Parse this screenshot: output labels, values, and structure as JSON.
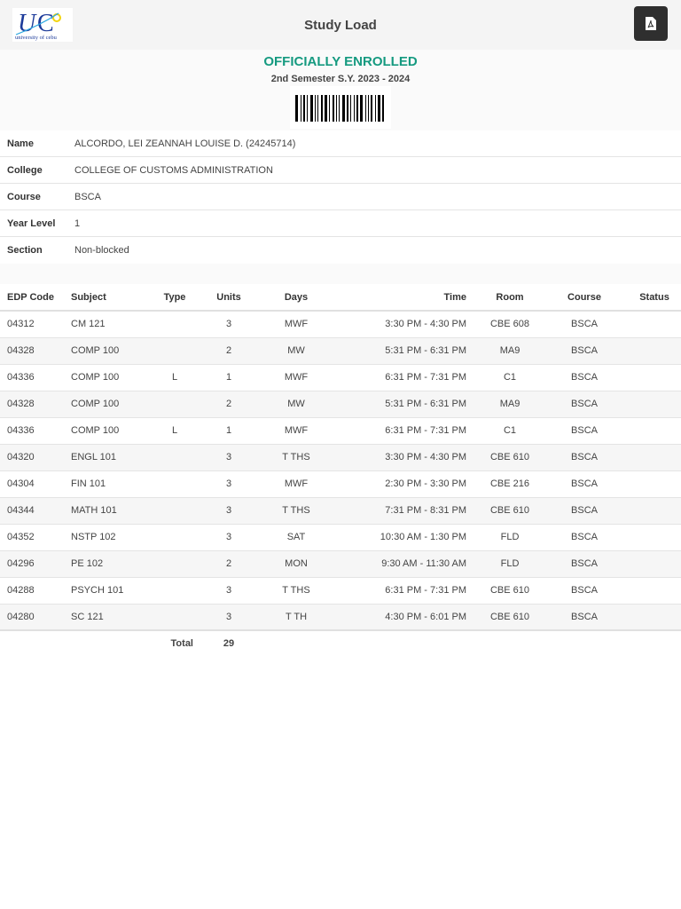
{
  "header": {
    "title": "Study Load",
    "logo_text": "UC university of cebu"
  },
  "status": {
    "label": "OFFICIALLY ENROLLED",
    "semester": "2nd Semester S.Y. 2023 - 2024",
    "color": "#159a80"
  },
  "student": [
    {
      "label": "Name",
      "value": "ALCORDO, LEI ZEANNAH LOUISE D. (24245714)"
    },
    {
      "label": "College",
      "value": "COLLEGE OF CUSTOMS ADMINISTRATION"
    },
    {
      "label": "Course",
      "value": "BSCA"
    },
    {
      "label": "Year Level",
      "value": "1"
    },
    {
      "label": "Section",
      "value": "Non-blocked"
    }
  ],
  "table": {
    "headers": [
      "EDP Code",
      "Subject",
      "Type",
      "Units",
      "Days",
      "Time",
      "Room",
      "Course",
      "Status"
    ],
    "rows": [
      [
        "04312",
        "CM 121",
        "",
        "3",
        "MWF",
        "3:30 PM - 4:30 PM",
        "CBE 608",
        "BSCA",
        ""
      ],
      [
        "04328",
        "COMP 100",
        "",
        "2",
        "MW",
        "5:31 PM - 6:31 PM",
        "MA9",
        "BSCA",
        ""
      ],
      [
        "04336",
        "COMP 100",
        "L",
        "1",
        "MWF",
        "6:31 PM - 7:31 PM",
        "C1",
        "BSCA",
        ""
      ],
      [
        "04328",
        "COMP 100",
        "",
        "2",
        "MW",
        "5:31 PM - 6:31 PM",
        "MA9",
        "BSCA",
        ""
      ],
      [
        "04336",
        "COMP 100",
        "L",
        "1",
        "MWF",
        "6:31 PM - 7:31 PM",
        "C1",
        "BSCA",
        ""
      ],
      [
        "04320",
        "ENGL 101",
        "",
        "3",
        "T THS",
        "3:30 PM - 4:30 PM",
        "CBE 610",
        "BSCA",
        ""
      ],
      [
        "04304",
        "FIN 101",
        "",
        "3",
        "MWF",
        "2:30 PM - 3:30 PM",
        "CBE 216",
        "BSCA",
        ""
      ],
      [
        "04344",
        "MATH 101",
        "",
        "3",
        "T THS",
        "7:31 PM - 8:31 PM",
        "CBE 610",
        "BSCA",
        ""
      ],
      [
        "04352",
        "NSTP 102",
        "",
        "3",
        "SAT",
        "10:30 AM - 1:30 PM",
        "FLD",
        "BSCA",
        ""
      ],
      [
        "04296",
        "PE 102",
        "",
        "2",
        "MON",
        "9:30 AM - 11:30 AM",
        "FLD",
        "BSCA",
        ""
      ],
      [
        "04288",
        "PSYCH 101",
        "",
        "3",
        "T THS",
        "6:31 PM - 7:31 PM",
        "CBE 610",
        "BSCA",
        ""
      ],
      [
        "04280",
        "SC 121",
        "",
        "3",
        "T TH",
        "4:30 PM - 6:01 PM",
        "CBE 610",
        "BSCA",
        ""
      ]
    ],
    "total_label": "Total",
    "total_units": "29"
  }
}
